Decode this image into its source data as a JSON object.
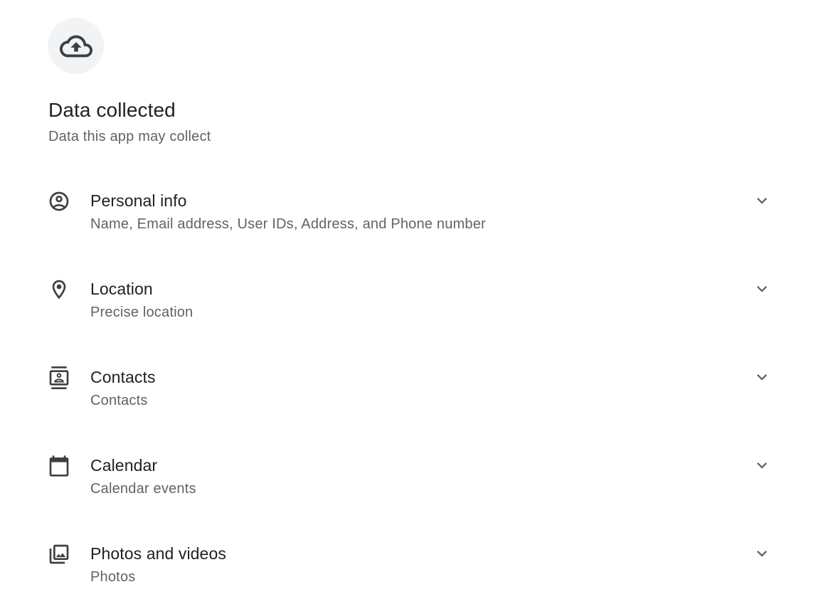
{
  "header": {
    "icon": "cloud-upload-icon",
    "title": "Data collected",
    "subtitle": "Data this app may collect"
  },
  "items": [
    {
      "icon": "account-circle-icon",
      "title": "Personal info",
      "description": "Name, Email address, User IDs, Address, and Phone number"
    },
    {
      "icon": "location-pin-icon",
      "title": "Location",
      "description": "Precise location"
    },
    {
      "icon": "contacts-icon",
      "title": "Contacts",
      "description": "Contacts"
    },
    {
      "icon": "calendar-icon",
      "title": "Calendar",
      "description": "Calendar events"
    },
    {
      "icon": "photo-library-icon",
      "title": "Photos and videos",
      "description": "Photos"
    }
  ],
  "colors": {
    "primary_text": "#202124",
    "secondary_text": "#5f6368",
    "icon": "#3c4043",
    "icon_bg": "#f1f3f4"
  }
}
